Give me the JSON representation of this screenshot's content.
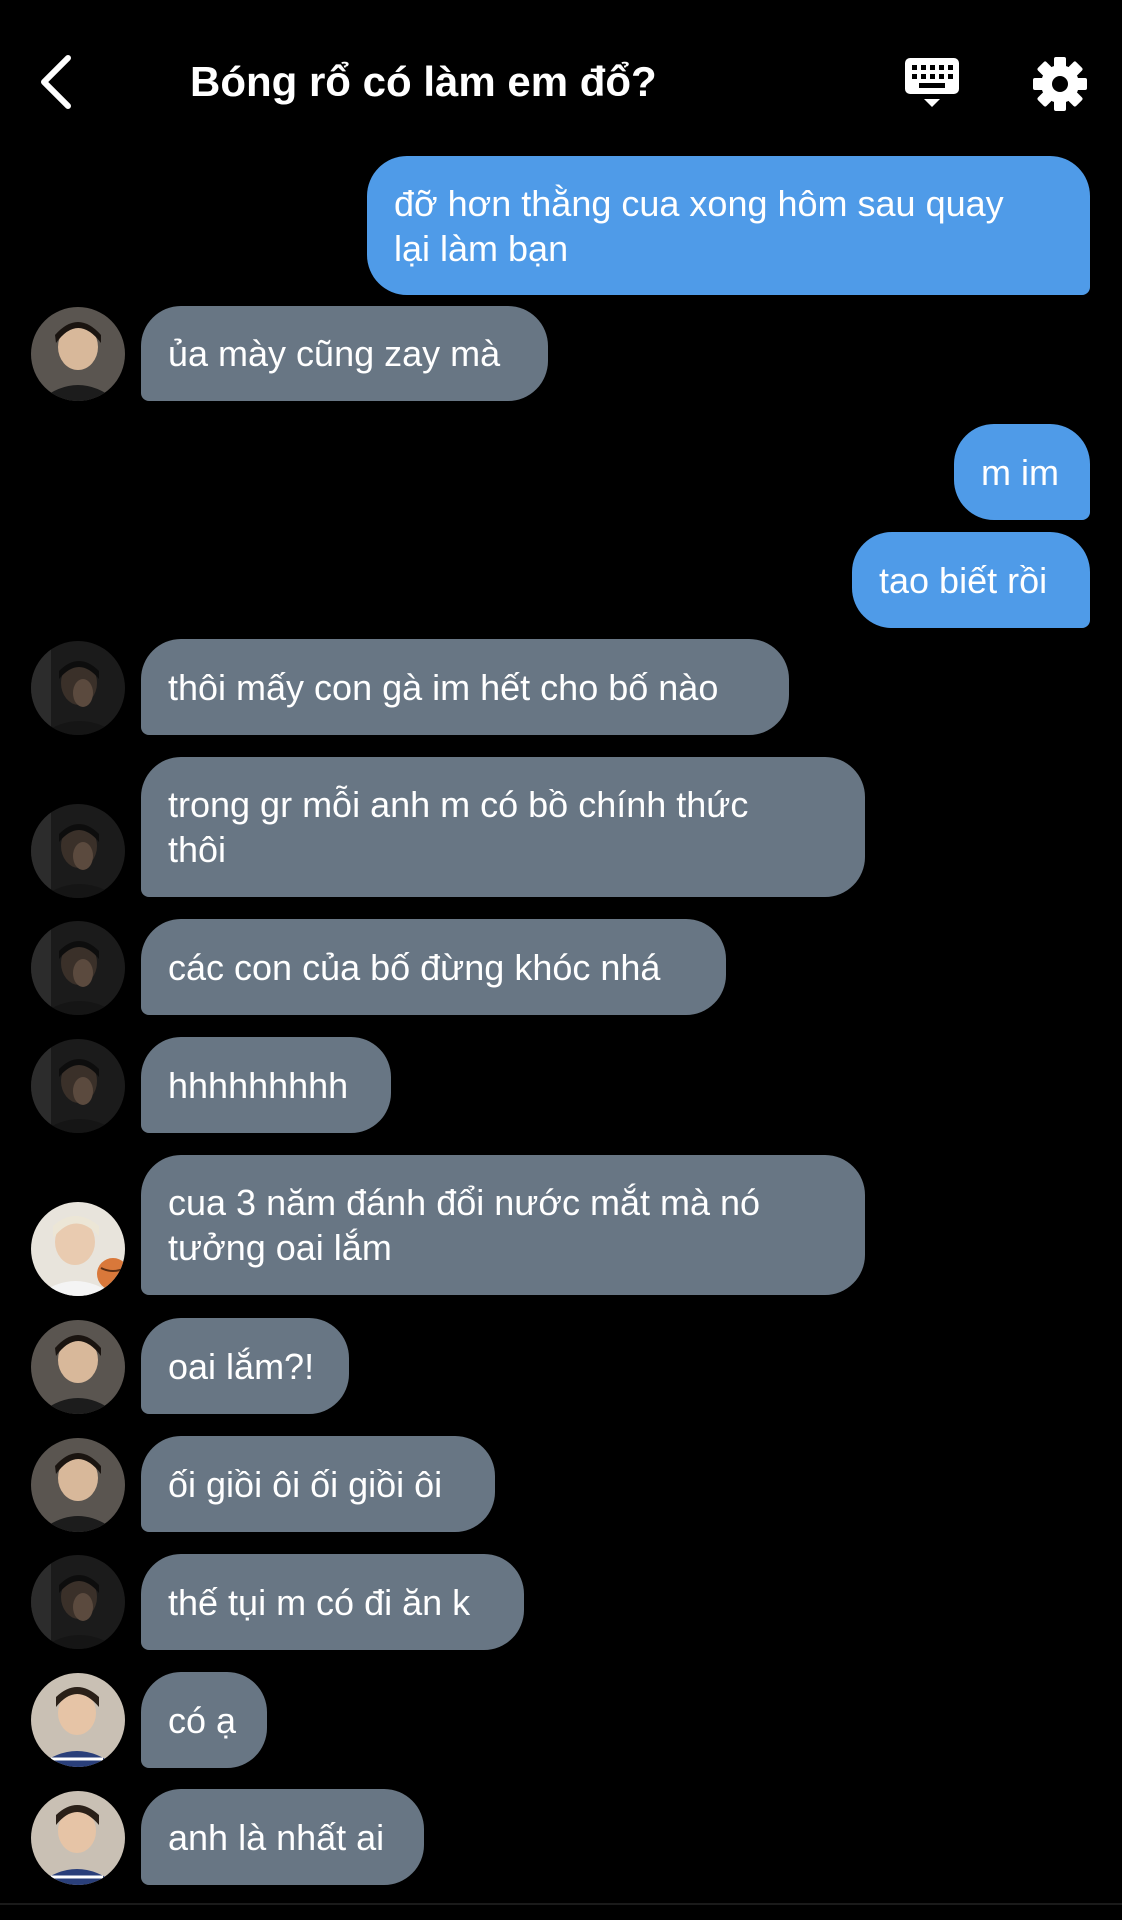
{
  "header": {
    "title": "Bóng rổ có làm em đổ?",
    "back_icon": "chevron-left-icon",
    "keyboard_icon": "keyboard-icon",
    "settings_icon": "gear-icon"
  },
  "colors": {
    "background": "#000000",
    "outgoing_bubble": "#4f9be8",
    "incoming_bubble": "#687684",
    "text": "#ffffff"
  },
  "messages": [
    {
      "sender": "me",
      "text_lines": [
        "đỡ hơn thằng cua xong hôm sau quay",
        "lại làm bạn"
      ]
    },
    {
      "sender": "them",
      "avatar": "avatar-a",
      "text_lines": [
        "ủa mày cũng zay mà"
      ]
    },
    {
      "sender": "me",
      "text_lines": [
        "m im"
      ]
    },
    {
      "sender": "me",
      "text_lines": [
        "tao biết rồi"
      ]
    },
    {
      "sender": "them",
      "avatar": "avatar-b",
      "text_lines": [
        "thôi mấy con gà im hết cho bố nào"
      ]
    },
    {
      "sender": "them",
      "avatar": "avatar-b",
      "text_lines": [
        "trong gr mỗi anh m có bồ chính thức",
        "thôi"
      ]
    },
    {
      "sender": "them",
      "avatar": "avatar-b",
      "text_lines": [
        "các con của bố đừng khóc nhá"
      ]
    },
    {
      "sender": "them",
      "avatar": "avatar-b",
      "text_lines": [
        "hhhhhhhhh"
      ]
    },
    {
      "sender": "them",
      "avatar": "avatar-c",
      "text_lines": [
        "cua 3 năm đánh đổi nước mắt mà nó",
        "tưởng oai lắm"
      ]
    },
    {
      "sender": "them",
      "avatar": "avatar-a",
      "text_lines": [
        "oai lắm?!"
      ]
    },
    {
      "sender": "them",
      "avatar": "avatar-a",
      "text_lines": [
        "ối giồi ôi ối giồi ôi"
      ]
    },
    {
      "sender": "them",
      "avatar": "avatar-b",
      "text_lines": [
        "thế tụi m có đi ăn k"
      ]
    },
    {
      "sender": "them",
      "avatar": "avatar-d",
      "text_lines": [
        "có ạ"
      ]
    },
    {
      "sender": "them",
      "avatar": "avatar-d",
      "text_lines": [
        "anh là nhất ai"
      ]
    }
  ]
}
